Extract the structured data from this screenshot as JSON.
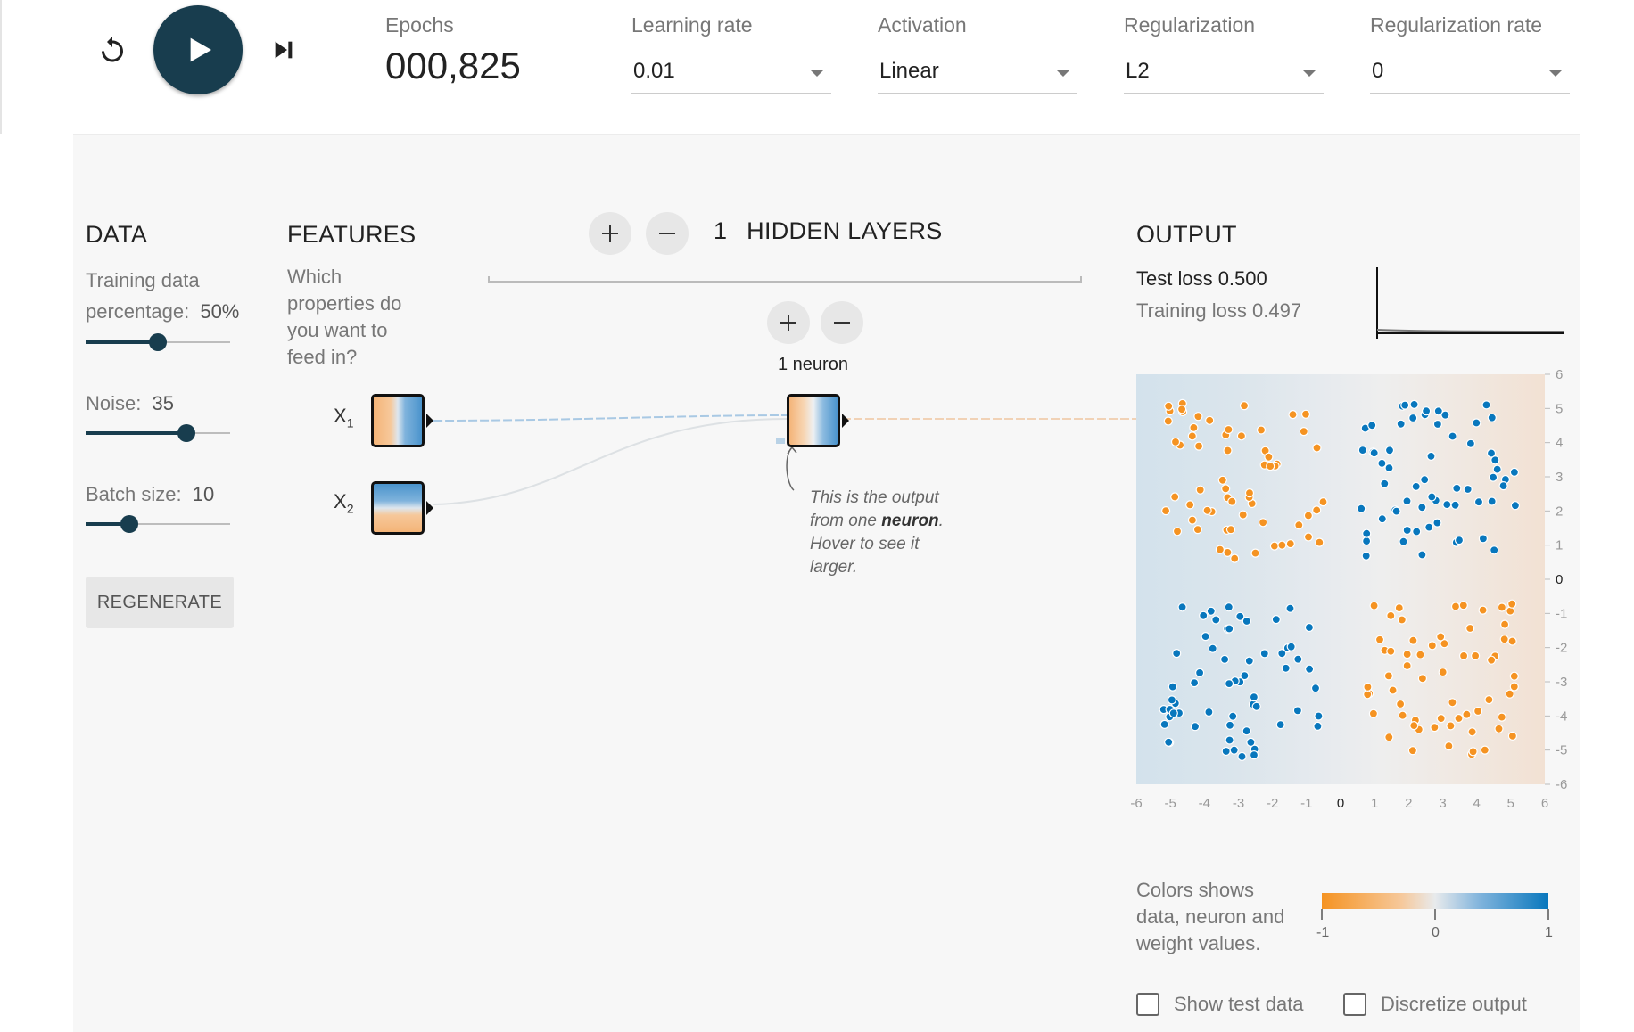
{
  "controls": {
    "epochs_label": "Epochs",
    "epochs_value": "000,825",
    "learning_rate": {
      "label": "Learning rate",
      "value": "0.01"
    },
    "activation": {
      "label": "Activation",
      "value": "Linear"
    },
    "regularization": {
      "label": "Regularization",
      "value": "L2"
    },
    "regularization_rate": {
      "label": "Regularization rate",
      "value": "0"
    }
  },
  "data_panel": {
    "title": "DATA",
    "training_label_1": "Training data",
    "training_label_2": "percentage:",
    "training_value": "50%",
    "training_fraction": 0.5,
    "noise_label": "Noise:",
    "noise_value": "35",
    "noise_fraction": 0.7,
    "batch_label": "Batch size:",
    "batch_value": "10",
    "batch_fraction": 0.3,
    "regenerate_label": "REGENERATE"
  },
  "features_panel": {
    "title": "FEATURES",
    "description": [
      "Which",
      "properties do",
      "you want to",
      "feed in?"
    ],
    "x1": "X",
    "x1_sub": "1",
    "x2": "X",
    "x2_sub": "2"
  },
  "hidden_panel": {
    "count": "1",
    "title": "HIDDEN LAYERS",
    "neuron_count_label": "1 neuron",
    "callout": [
      "This is the output",
      "from one ",
      "neuron",
      ".",
      "Hover to see it",
      "larger."
    ]
  },
  "output_panel": {
    "title": "OUTPUT",
    "test_loss": "Test loss 0.500",
    "training_loss": "Training loss 0.497",
    "x_ticks": [
      "-6",
      "-5",
      "-4",
      "-3",
      "-2",
      "-1",
      "0",
      "1",
      "2",
      "3",
      "4",
      "5",
      "6"
    ],
    "y_ticks": [
      "6",
      "5",
      "4",
      "3",
      "2",
      "1",
      "0",
      "-1",
      "-2",
      "-3",
      "-4",
      "-5",
      "-6"
    ],
    "legend_text": [
      "Colors shows",
      "data, neuron and",
      "weight values."
    ],
    "legend_ticks": [
      "-1",
      "0",
      "1"
    ],
    "show_test_label": "Show test data",
    "discretize_label": "Discretize output"
  },
  "colors": {
    "orange": "#f59322",
    "blue": "#0877bd",
    "dark": "#183d4e"
  }
}
